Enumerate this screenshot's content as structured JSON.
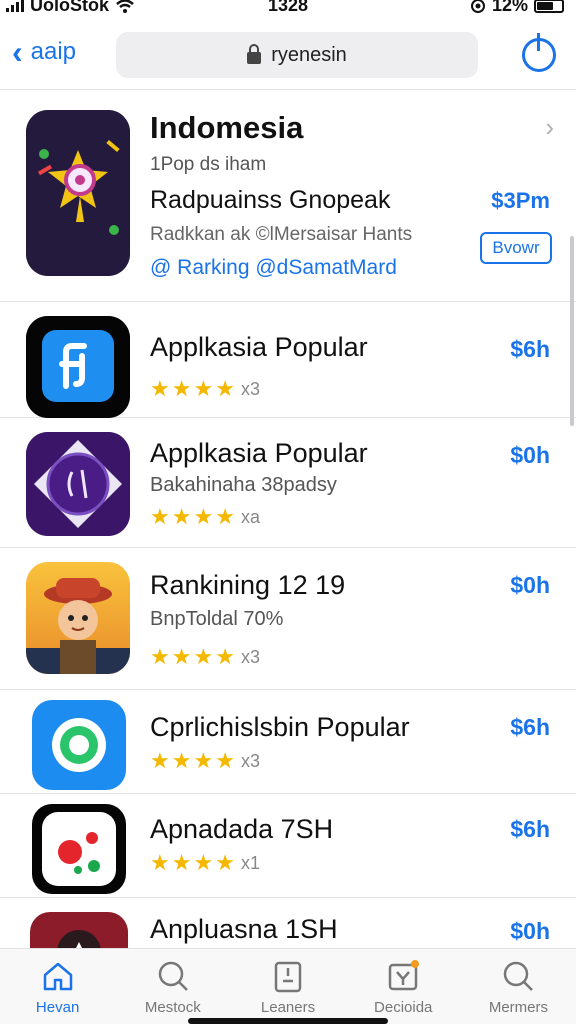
{
  "status": {
    "carrier": "UoloStok",
    "time": "1328",
    "battery": "12%"
  },
  "nav": {
    "back_label": "aaip",
    "url": "ryenesin"
  },
  "featured": {
    "title": "Indomesia",
    "line1": "1Pop ds iham",
    "line2": "Radpuainss Gnopeak",
    "line3": "Radkkan ak ©lMersaisar Hants",
    "line4": "@ Rarking @dSamatMard",
    "price": "$3Pm",
    "button": "Bvowr"
  },
  "apps": [
    {
      "title": "Applkasia Popular",
      "subtitle": "",
      "price": "$6h",
      "rating_suffix": "x3"
    },
    {
      "title": "Applkasia Popular",
      "subtitle": "Bakahinaha 38padsy",
      "price": "$0h",
      "rating_suffix": "xa"
    },
    {
      "title": "Rankining 12 19",
      "subtitle": "BnpToldal 70%",
      "price": "$0h",
      "rating_suffix": "x3"
    },
    {
      "title": "Cprlichislsbin Popular",
      "subtitle": "",
      "price": "$6h",
      "rating_suffix": "x3"
    },
    {
      "title": "Apnadada 7SH",
      "subtitle": "",
      "price": "$6h",
      "rating_suffix": "x1"
    },
    {
      "title": "Anpluasna 1SH",
      "subtitle": "",
      "price": "$0h",
      "rating_suffix": ""
    }
  ],
  "tabs": [
    {
      "label": "Hevan",
      "icon": "home-icon"
    },
    {
      "label": "Mestock",
      "icon": "search-icon"
    },
    {
      "label": "Leaners",
      "icon": "clipboard-icon"
    },
    {
      "label": "Decioida",
      "icon": "gift-icon"
    },
    {
      "label": "Mermers",
      "icon": "search-icon"
    }
  ],
  "colors": {
    "accent": "#1a73e8",
    "star": "#f5b800"
  }
}
